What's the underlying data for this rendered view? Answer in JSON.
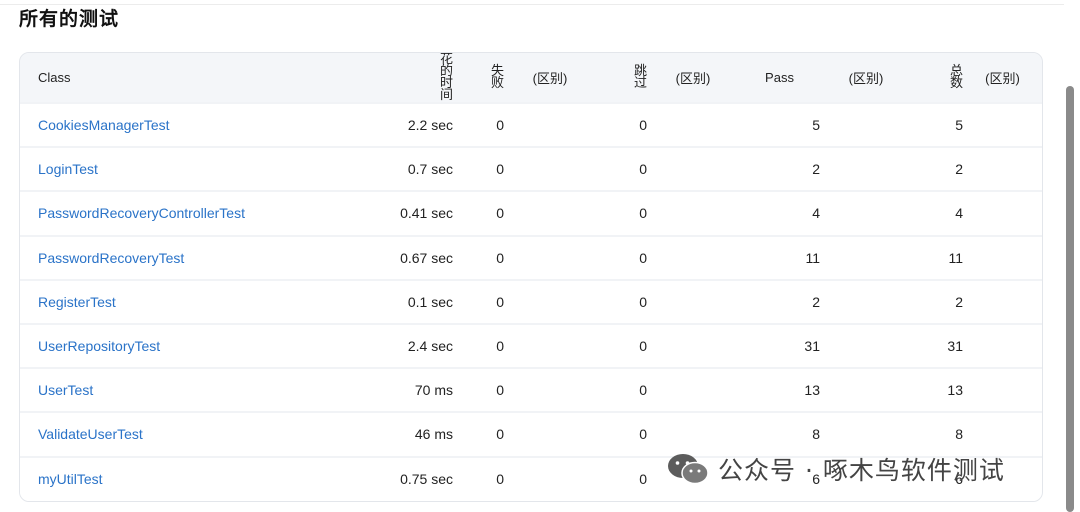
{
  "page": {
    "title": "所有的测试"
  },
  "table": {
    "headers": {
      "class": "Class",
      "duration": "花的时间",
      "failed": "失败",
      "failed_diff": "(区别)",
      "skipped": "跳过",
      "skipped_diff": "(区别)",
      "pass": "Pass",
      "pass_diff": "(区别)",
      "total": "总数",
      "total_diff": "(区别)"
    },
    "rows": [
      {
        "name": "CookiesManagerTest",
        "duration": "2.2 sec",
        "failed": "0",
        "skipped": "0",
        "pass": "5",
        "total": "5"
      },
      {
        "name": "LoginTest",
        "duration": "0.7 sec",
        "failed": "0",
        "skipped": "0",
        "pass": "2",
        "total": "2"
      },
      {
        "name": "PasswordRecoveryControllerTest",
        "duration": "0.41 sec",
        "failed": "0",
        "skipped": "0",
        "pass": "4",
        "total": "4"
      },
      {
        "name": "PasswordRecoveryTest",
        "duration": "0.67 sec",
        "failed": "0",
        "skipped": "0",
        "pass": "11",
        "total": "11"
      },
      {
        "name": "RegisterTest",
        "duration": "0.1 sec",
        "failed": "0",
        "skipped": "0",
        "pass": "2",
        "total": "2"
      },
      {
        "name": "UserRepositoryTest",
        "duration": "2.4 sec",
        "failed": "0",
        "skipped": "0",
        "pass": "31",
        "total": "31"
      },
      {
        "name": "UserTest",
        "duration": "70 ms",
        "failed": "0",
        "skipped": "0",
        "pass": "13",
        "total": "13"
      },
      {
        "name": "ValidateUserTest",
        "duration": "46 ms",
        "failed": "0",
        "skipped": "0",
        "pass": "8",
        "total": "8"
      },
      {
        "name": "myUtilTest",
        "duration": "0.75 sec",
        "failed": "0",
        "skipped": "0",
        "pass": "6",
        "total": "6"
      }
    ]
  },
  "watermark": {
    "text": "公众号 · 啄木鸟软件测试",
    "logo_icon": "wechat-icon"
  },
  "colors": {
    "link": "#2a73c8",
    "header_bg": "#f4f6f9",
    "row_bg": "#ffffff"
  }
}
